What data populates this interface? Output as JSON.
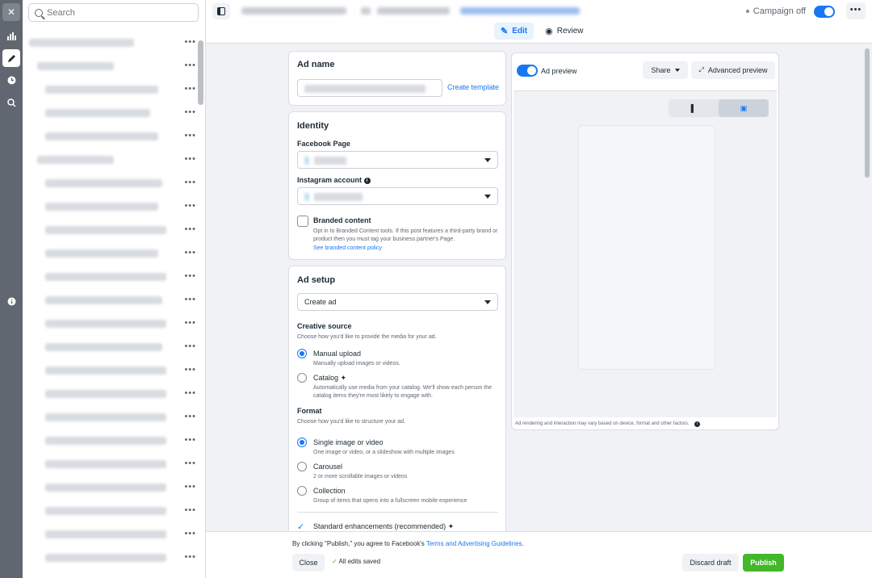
{
  "sidebar": {
    "search_placeholder": "Search"
  },
  "topbar": {
    "campaign_status": "Campaign off",
    "tabs": [
      {
        "label": "Edit",
        "icon": "pencil-icon"
      },
      {
        "label": "Review",
        "icon": "eye-icon"
      }
    ]
  },
  "ad_name": {
    "title": "Ad name",
    "create_template": "Create template"
  },
  "identity": {
    "title": "Identity",
    "facebook_page_label": "Facebook Page",
    "instagram_label": "Instagram account",
    "branded_content_title": "Branded content",
    "branded_content_desc": "Opt in to Branded Content tools. If this post features a third-party brand or product then you must tag your business partner's Page.",
    "branded_content_link": "See branded content policy"
  },
  "ad_setup": {
    "title": "Ad setup",
    "select_value": "Create ad",
    "creative_source_title": "Creative source",
    "creative_source_desc": "Choose how you'd like to provide the media for your ad.",
    "options_source": [
      {
        "title": "Manual upload",
        "desc": "Manually upload images or videos.",
        "selected": true
      },
      {
        "title": "Catalog",
        "desc": "Automatically use media from your catalog. We'll show each person the catalog items they're most likely to engage with.",
        "selected": false
      }
    ],
    "format_title": "Format",
    "format_desc": "Choose how you'd like to structure your ad.",
    "options_format": [
      {
        "title": "Single image or video",
        "desc": "One image or video, or a slideshow with multiple images",
        "selected": true
      },
      {
        "title": "Carousel",
        "desc": "2 or more scrollable images or videos",
        "selected": false
      },
      {
        "title": "Collection",
        "desc": "Group of items that opens into a fullscreen mobile experience",
        "selected": false
      }
    ],
    "enhancements": "Standard enhancements (recommended)"
  },
  "preview": {
    "toggle_label": "Ad preview",
    "share_label": "Share",
    "advanced_label": "Advanced preview",
    "disclaimer": "Ad rendering and interaction may vary based on device, format and other factors."
  },
  "footer": {
    "terms_prefix": "By clicking \"Publish,\" you agree to Facebook's ",
    "terms_link": "Terms and Advertising Guidelines",
    "terms_suffix": ".",
    "close_label": "Close",
    "saved_label": "All edits saved",
    "discard_label": "Discard draft",
    "publish_label": "Publish"
  },
  "colors": {
    "accent": "#1877f2",
    "publish": "#42b72a",
    "rail": "#606770"
  }
}
